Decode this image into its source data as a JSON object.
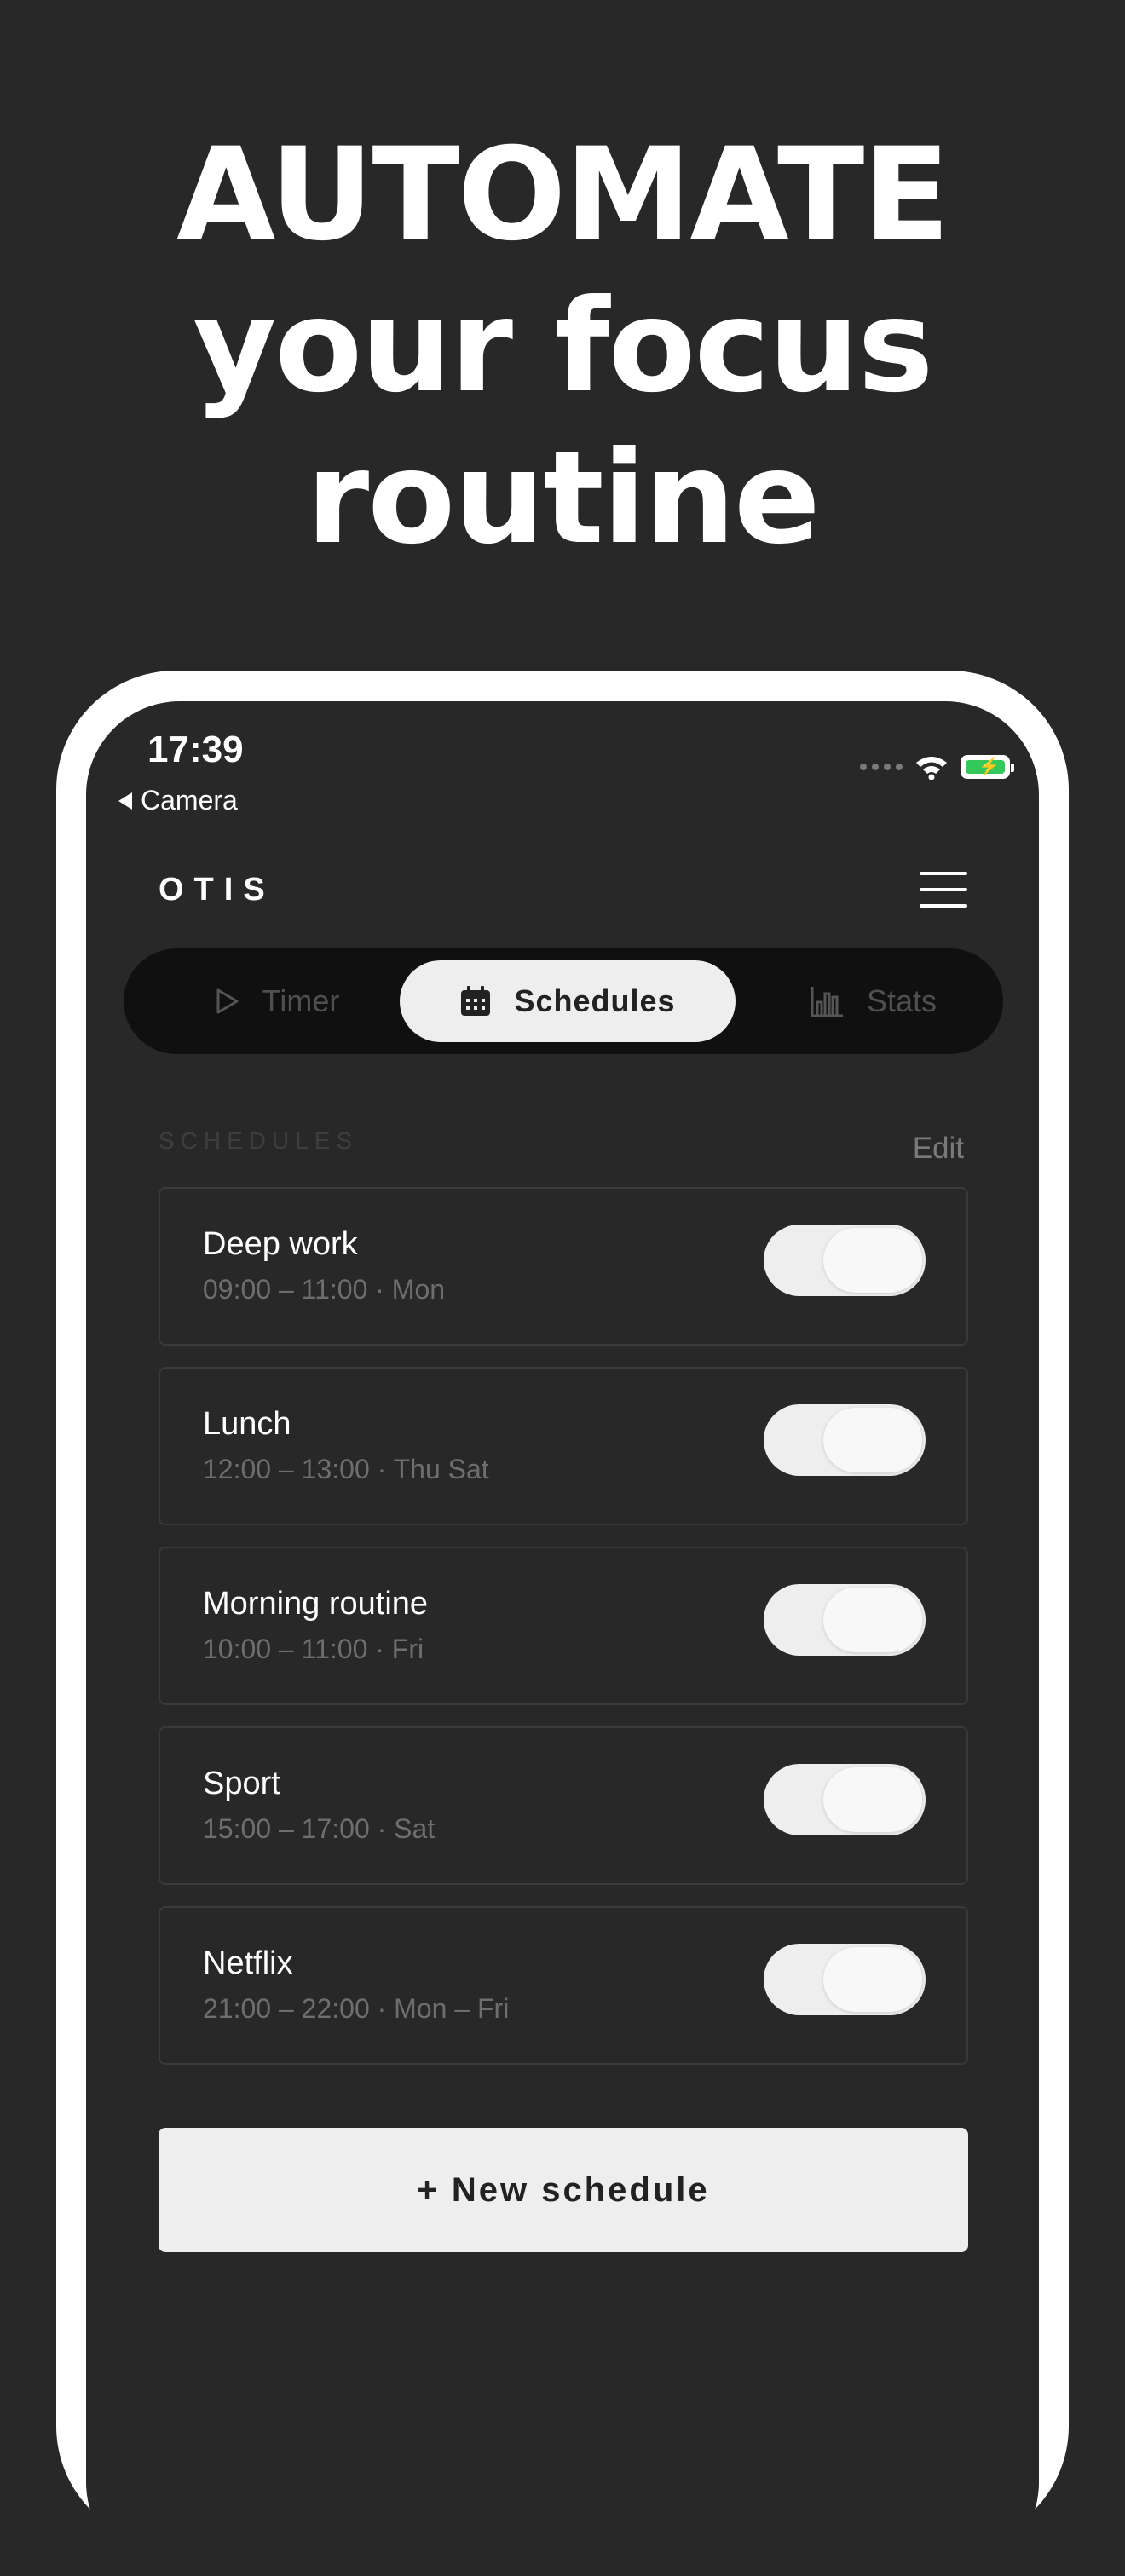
{
  "headline": {
    "line1": "AUTOMATE",
    "line2": "your focus",
    "line3": "routine"
  },
  "status_bar": {
    "time": "17:39",
    "back_label": "Camera"
  },
  "app": {
    "logo": "OTIS"
  },
  "tabs": [
    {
      "label": "Timer",
      "icon": "play-icon",
      "active": false
    },
    {
      "label": "Schedules",
      "icon": "calendar-icon",
      "active": true
    },
    {
      "label": "Stats",
      "icon": "bar-chart-icon",
      "active": false
    }
  ],
  "section": {
    "title": "SCHEDULES",
    "edit_label": "Edit"
  },
  "schedules": [
    {
      "name": "Deep work",
      "details": "09:00 – 11:00 · Mon",
      "enabled": true
    },
    {
      "name": "Lunch",
      "details": "12:00 – 13:00 · Thu Sat",
      "enabled": true
    },
    {
      "name": "Morning routine",
      "details": "10:00 – 11:00 · Fri",
      "enabled": true
    },
    {
      "name": "Sport",
      "details": "15:00 – 17:00 · Sat",
      "enabled": true
    },
    {
      "name": "Netflix",
      "details": "21:00 – 22:00 · Mon – Fri",
      "enabled": true
    }
  ],
  "new_schedule_label": "+ New schedule",
  "colors": {
    "background": "#282828",
    "pill": "#eeeeee",
    "battery": "#34c759"
  }
}
